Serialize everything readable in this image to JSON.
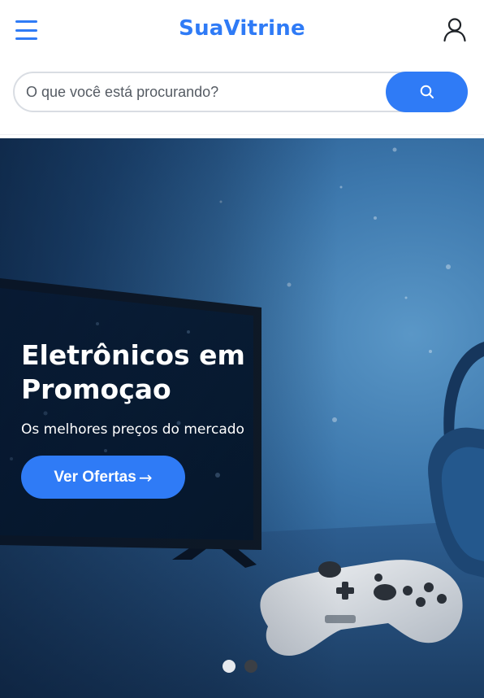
{
  "header": {
    "brand": "SuaVitrine",
    "menu_icon": "hamburger-menu-icon",
    "user_icon": "user-icon",
    "accent_color": "#2f7bf6"
  },
  "search": {
    "placeholder": "O que você está procurando?",
    "value": "",
    "button_icon": "search-icon"
  },
  "banner": {
    "title": "Eletrônicos em Promoçao",
    "subtitle": "Os melhores preços do mercado",
    "cta_label": "Ver Ofertas",
    "cta_icon": "arrow-right-icon",
    "cta_arrow": "→",
    "slides_total": 2,
    "active_slide": 1
  }
}
